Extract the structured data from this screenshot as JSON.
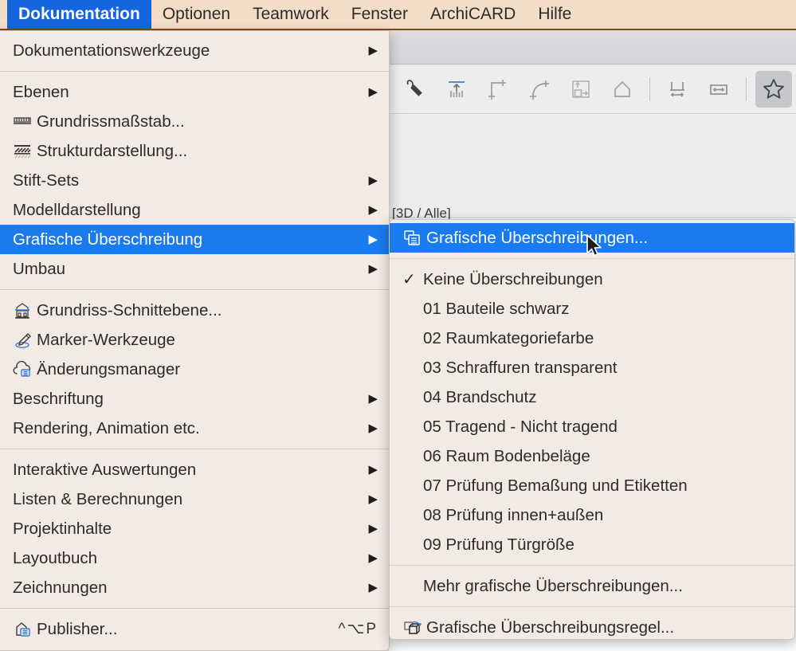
{
  "menubar": {
    "items": [
      {
        "label": "Dokumentation",
        "selected": true
      },
      {
        "label": "Optionen",
        "selected": false
      },
      {
        "label": "Teamwork",
        "selected": false
      },
      {
        "label": "Fenster",
        "selected": false
      },
      {
        "label": "ArchiCARD",
        "selected": false
      },
      {
        "label": "Hilfe",
        "selected": false
      }
    ]
  },
  "colors": {
    "menubar_bg": "#f4ddc7",
    "menubar_border": "#7a4a18",
    "menu_bg": "#f3eae6",
    "highlight_blue": "#1a7aef",
    "menubar_selected_blue": "#1565e0",
    "text": "#2c2b29"
  },
  "toolbar": {
    "tools": [
      {
        "name": "magic-wand-icon",
        "active": false
      },
      {
        "name": "column-chart-icon",
        "active": false
      },
      {
        "name": "corner-polyline-icon",
        "active": false
      },
      {
        "name": "arc-curve-icon",
        "active": false
      },
      {
        "name": "offset-box-icon",
        "active": false
      },
      {
        "name": "home-pentagon-icon",
        "active": false
      },
      {
        "name": "separator",
        "active": false
      },
      {
        "name": "vertical-distance-icon",
        "active": false
      },
      {
        "name": "horizontal-distance-icon",
        "active": false
      },
      {
        "name": "separator",
        "active": false
      },
      {
        "name": "star-favorite-icon",
        "active": true
      }
    ]
  },
  "document": {
    "tab_label": "[3D / Alle]"
  },
  "main_menu": {
    "items": [
      {
        "label": "Dokumentationswerkzeuge",
        "icon": null,
        "arrow": true,
        "highlight": false
      },
      {
        "type": "separator"
      },
      {
        "label": "Ebenen",
        "icon": null,
        "arrow": true,
        "highlight": false
      },
      {
        "label": "Grundrissmaßstab...",
        "icon": "ruler-icon",
        "arrow": false,
        "highlight": false
      },
      {
        "label": "Strukturdarstellung...",
        "icon": "hatch-layers-icon",
        "arrow": false,
        "highlight": false
      },
      {
        "label": "Stift-Sets",
        "icon": null,
        "arrow": true,
        "highlight": false
      },
      {
        "label": "Modelldarstellung",
        "icon": null,
        "arrow": true,
        "highlight": false
      },
      {
        "label": "Grafische Überschreibung",
        "icon": null,
        "arrow": true,
        "highlight": true
      },
      {
        "label": "Umbau",
        "icon": null,
        "arrow": true,
        "highlight": false
      },
      {
        "type": "separator"
      },
      {
        "label": "Grundriss-Schnittebene...",
        "icon": "building-section-icon",
        "arrow": false,
        "highlight": false
      },
      {
        "label": "Marker-Werkzeuge",
        "icon": "marker-pen-icon",
        "arrow": false,
        "highlight": false
      },
      {
        "label": "Änderungsmanager",
        "icon": "cloud-list-icon",
        "arrow": false,
        "highlight": false
      },
      {
        "label": "Beschriftung",
        "icon": null,
        "arrow": true,
        "highlight": false
      },
      {
        "label": "Rendering, Animation etc.",
        "icon": null,
        "arrow": true,
        "highlight": false
      },
      {
        "type": "separator"
      },
      {
        "label": "Interaktive Auswertungen",
        "icon": null,
        "arrow": true,
        "highlight": false
      },
      {
        "label": "Listen & Berechnungen",
        "icon": null,
        "arrow": true,
        "highlight": false
      },
      {
        "label": "Projektinhalte",
        "icon": null,
        "arrow": true,
        "highlight": false
      },
      {
        "label": "Layoutbuch",
        "icon": null,
        "arrow": true,
        "highlight": false
      },
      {
        "label": "Zeichnungen",
        "icon": null,
        "arrow": true,
        "highlight": false
      },
      {
        "type": "separator"
      },
      {
        "label": "Publisher...",
        "icon": "publisher-icon",
        "arrow": false,
        "highlight": false,
        "shortcut": "^⌥P"
      }
    ]
  },
  "sub_menu": {
    "items": [
      {
        "label": "Grafische Überschreibungen...",
        "icon": "overrides-icon",
        "highlight": true,
        "checked": false
      },
      {
        "type": "separator"
      },
      {
        "label": "Keine Überschreibungen",
        "icon": null,
        "highlight": false,
        "checked": true
      },
      {
        "label": "01 Bauteile schwarz",
        "icon": null,
        "highlight": false,
        "checked": false
      },
      {
        "label": "02 Raumkategoriefarbe",
        "icon": null,
        "highlight": false,
        "checked": false
      },
      {
        "label": "03 Schraffuren transparent",
        "icon": null,
        "highlight": false,
        "checked": false
      },
      {
        "label": "04 Brandschutz",
        "icon": null,
        "highlight": false,
        "checked": false
      },
      {
        "label": "05 Tragend - Nicht tragend",
        "icon": null,
        "highlight": false,
        "checked": false
      },
      {
        "label": "06 Raum Bodenbeläge",
        "icon": null,
        "highlight": false,
        "checked": false
      },
      {
        "label": "07 Prüfung Bemaßung und Etiketten",
        "icon": null,
        "highlight": false,
        "checked": false
      },
      {
        "label": "08 Prüfung innen+außen",
        "icon": null,
        "highlight": false,
        "checked": false
      },
      {
        "label": "09 Prüfung Türgröße",
        "icon": null,
        "highlight": false,
        "checked": false
      },
      {
        "type": "separator"
      },
      {
        "label": "Mehr grafische Überschreibungen...",
        "icon": null,
        "highlight": false,
        "checked": false
      },
      {
        "type": "separator"
      },
      {
        "label": "Grafische Überschreibungsregel...",
        "icon": "override-rule-icon",
        "highlight": false,
        "checked": false
      }
    ]
  }
}
